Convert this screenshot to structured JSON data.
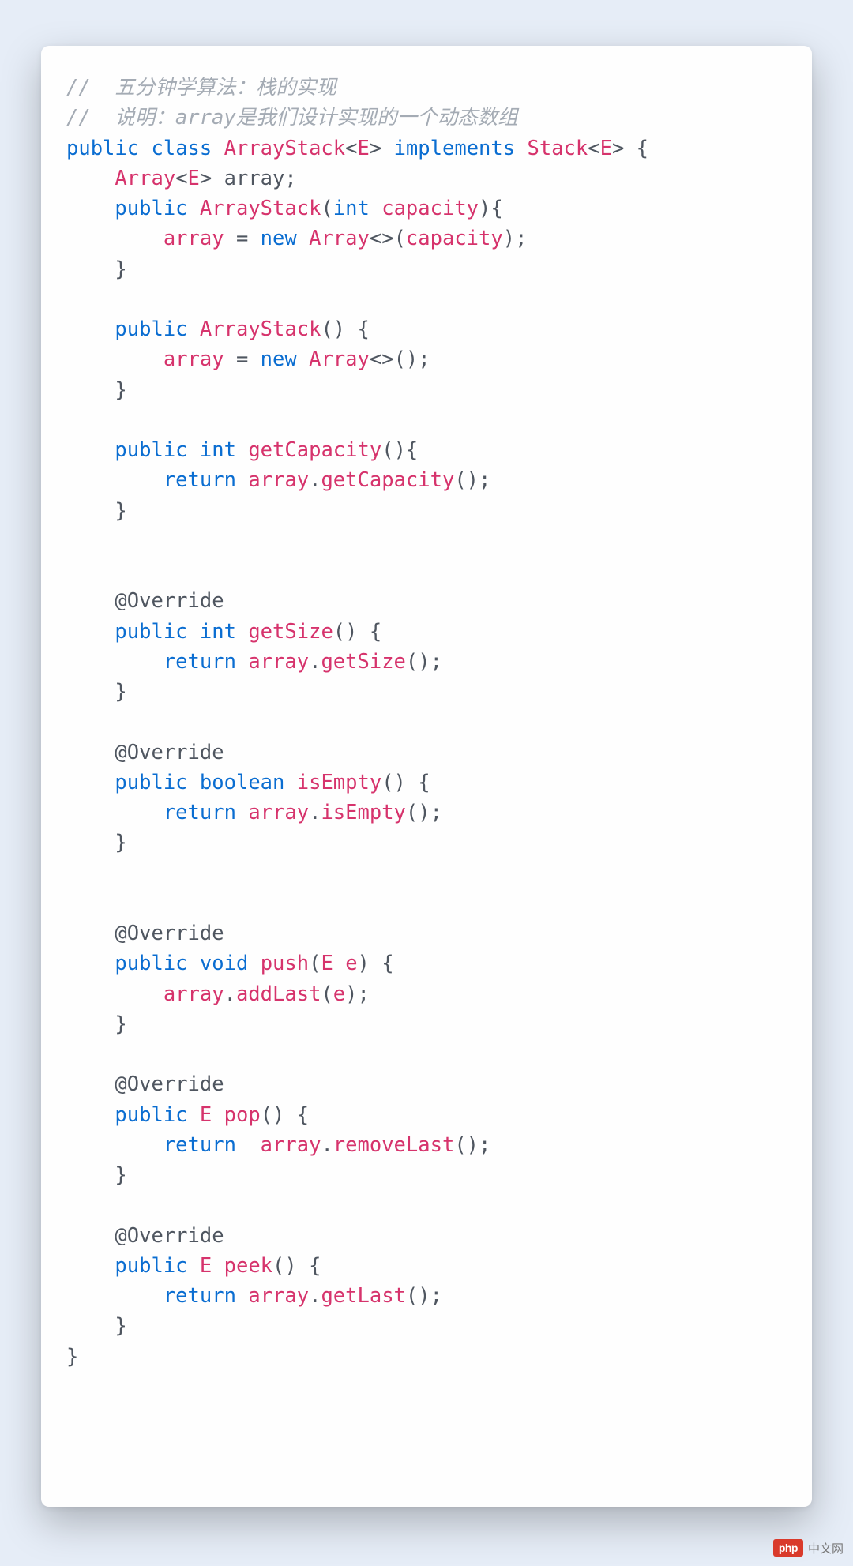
{
  "code": {
    "comment1": "//  五分钟学算法：栈的实现",
    "comment2": "//  说明：array是我们设计实现的一个动态数组",
    "kw_public": "public",
    "kw_class": "class",
    "kw_implements": "implements",
    "kw_int": "int",
    "kw_void": "void",
    "kw_boolean": "boolean",
    "kw_return": "return",
    "kw_new": "new",
    "name_ArrayStack": "ArrayStack",
    "name_Stack": "Stack",
    "name_Array": "Array",
    "gen_E": "E",
    "field_array": "array",
    "param_capacity": "capacity",
    "param_e": "e",
    "m_getCapacity": "getCapacity",
    "m_getSize": "getSize",
    "m_isEmpty": "isEmpty",
    "m_push": "push",
    "m_pop": "pop",
    "m_peek": "peek",
    "m_addLast": "addLast",
    "m_removeLast": "removeLast",
    "m_getLast": "getLast",
    "ann_Override": "@Override"
  },
  "watermark": {
    "logo": "php",
    "text": "中文网"
  }
}
